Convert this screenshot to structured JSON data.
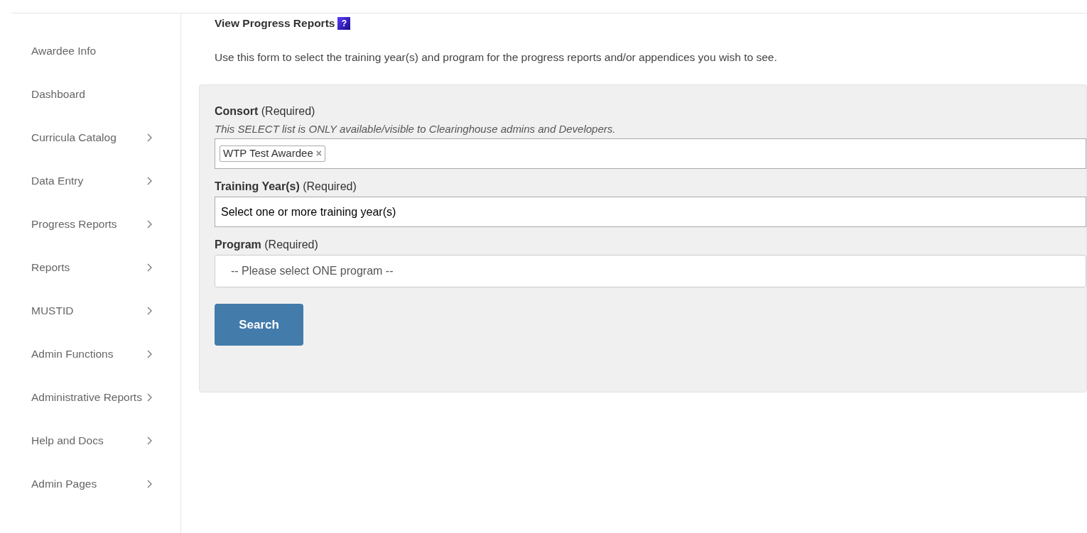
{
  "sidebar": {
    "items": [
      {
        "label": "Awardee Info",
        "submenu": false
      },
      {
        "label": "Dashboard",
        "submenu": false
      },
      {
        "label": "Curricula Catalog",
        "submenu": true
      },
      {
        "label": "Data Entry",
        "submenu": true
      },
      {
        "label": "Progress Reports",
        "submenu": true
      },
      {
        "label": "Reports",
        "submenu": true
      },
      {
        "label": "MUSTID",
        "submenu": true
      },
      {
        "label": "Admin Functions",
        "submenu": true
      },
      {
        "label": "Administrative Reports",
        "submenu": true
      },
      {
        "label": "Help and Docs",
        "submenu": true
      },
      {
        "label": "Admin Pages",
        "submenu": true
      }
    ]
  },
  "page": {
    "title": "View Progress Reports",
    "help_icon": "?",
    "intro": "Use this form to select the training year(s) and program for the progress reports and/or appendices you wish to see."
  },
  "form": {
    "consort": {
      "label": "Consort",
      "required": "(Required)",
      "note": "This SELECT list is ONLY available/visible to Clearinghouse admins and Developers.",
      "tags": [
        {
          "label": "WTP Test Awardee",
          "remove": "×"
        }
      ]
    },
    "training_years": {
      "label": "Training Year(s)",
      "required": "(Required)",
      "placeholder": "Select one or more training year(s)"
    },
    "program": {
      "label": "Program",
      "required": "(Required)",
      "value": "-- Please select ONE program --"
    },
    "search_button": "Search"
  }
}
